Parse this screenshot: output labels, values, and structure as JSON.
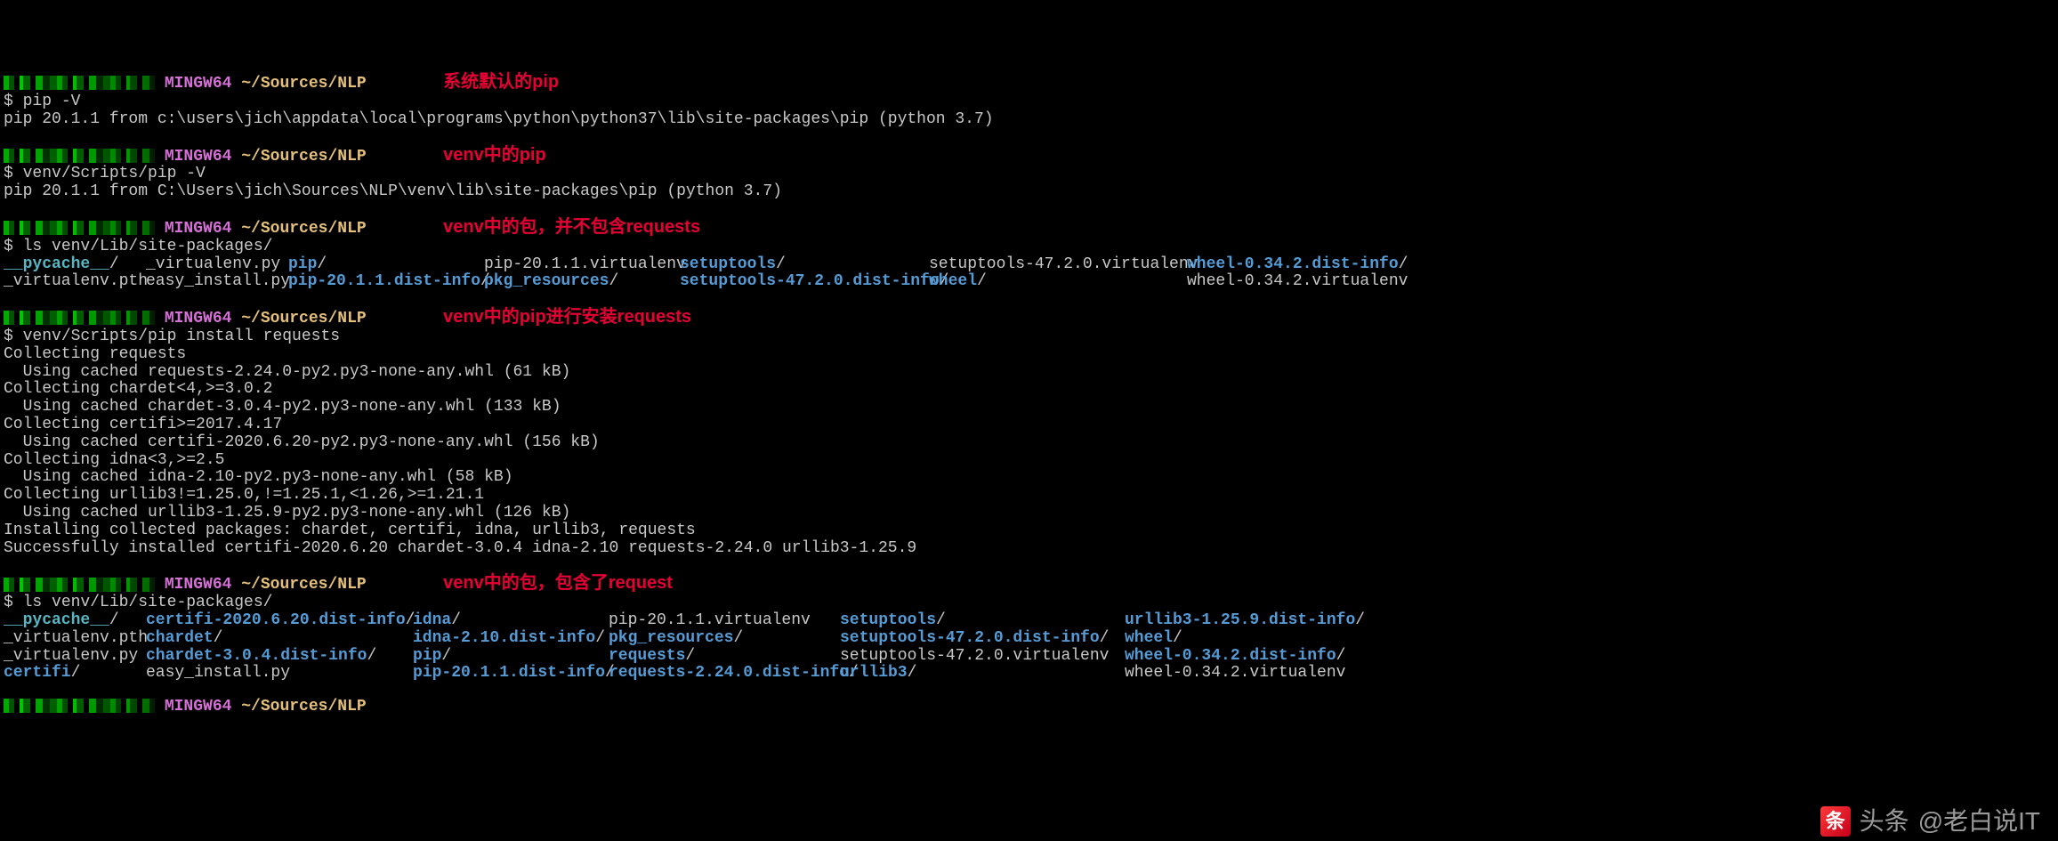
{
  "prompt": {
    "shell": "MINGW64",
    "path": "~/Sources/NLP"
  },
  "blocks": [
    {
      "ann": "系统默认的pip",
      "cmd": "pip -V",
      "out": [
        [
          "pip 20.1.1 from c:\\users\\jich\\appdata\\local\\programs\\python\\python37\\lib\\site-packages\\pip (python 3.7)"
        ]
      ]
    },
    {
      "ann": "venv中的pip",
      "cmd": "venv/Scripts/pip -V",
      "out": [
        [
          "pip 20.1.1 from C:\\Users\\jich\\Sources\\NLP\\venv\\lib\\site-packages\\pip (python 3.7)"
        ]
      ]
    },
    {
      "ann": "venv中的包，并不包含requests",
      "cmd": "ls venv/Lib/site-packages/",
      "ls": [
        [
          {
            "t": "__pycache__",
            "c": "cyan-link",
            "slash": "/"
          },
          {
            "t": "_virtualenv.py",
            "c": "white"
          },
          {
            "t": "pip",
            "c": "blue",
            "slash": "/"
          },
          {
            "t": "pip-20.1.1.virtualenv",
            "c": "white"
          },
          {
            "t": "setuptools",
            "c": "blue",
            "slash": "/"
          },
          {
            "t": "setuptools-47.2.0.virtualenv",
            "c": "white"
          },
          {
            "t": "wheel-0.34.2.dist-info",
            "c": "blue",
            "slash": "/"
          }
        ],
        [
          {
            "t": "_virtualenv.pth",
            "c": "white"
          },
          {
            "t": "easy_install.py",
            "c": "white"
          },
          {
            "t": "pip-20.1.1.dist-info",
            "c": "blue",
            "slash": "/"
          },
          {
            "t": "pkg_resources",
            "c": "blue",
            "slash": "/"
          },
          {
            "t": "setuptools-47.2.0.dist-info",
            "c": "blue",
            "slash": "/"
          },
          {
            "t": "wheel",
            "c": "blue",
            "slash": "/"
          },
          {
            "t": "wheel-0.34.2.virtualenv",
            "c": "white"
          }
        ]
      ],
      "ls_widths": [
        160,
        160,
        220,
        220,
        280,
        290,
        260
      ]
    },
    {
      "ann": "venv中的pip进行安装requests",
      "cmd": "venv/Scripts/pip install requests",
      "out": [
        [
          "Collecting requests"
        ],
        [
          "  Using cached requests-2.24.0-py2.py3-none-any.whl (61 kB)"
        ],
        [
          "Collecting chardet<4,>=3.0.2"
        ],
        [
          "  Using cached chardet-3.0.4-py2.py3-none-any.whl (133 kB)"
        ],
        [
          "Collecting certifi>=2017.4.17"
        ],
        [
          "  Using cached certifi-2020.6.20-py2.py3-none-any.whl (156 kB)"
        ],
        [
          "Collecting idna<3,>=2.5"
        ],
        [
          "  Using cached idna-2.10-py2.py3-none-any.whl (58 kB)"
        ],
        [
          "Collecting urllib3!=1.25.0,!=1.25.1,<1.26,>=1.21.1"
        ],
        [
          "  Using cached urllib3-1.25.9-py2.py3-none-any.whl (126 kB)"
        ],
        [
          "Installing collected packages: chardet, certifi, idna, urllib3, requests"
        ],
        [
          "Successfully installed certifi-2020.6.20 chardet-3.0.4 idna-2.10 requests-2.24.0 urllib3-1.25.9"
        ]
      ]
    },
    {
      "ann": "venv中的包，包含了request",
      "cmd": "ls venv/Lib/site-packages/",
      "ls": [
        [
          {
            "t": "__pycache__",
            "c": "cyan-link",
            "slash": "/"
          },
          {
            "t": "certifi-2020.6.20.dist-info",
            "c": "blue",
            "slash": "/"
          },
          {
            "t": "idna",
            "c": "blue",
            "slash": "/"
          },
          {
            "t": "pip-20.1.1.virtualenv",
            "c": "white"
          },
          {
            "t": "setuptools",
            "c": "blue",
            "slash": "/"
          },
          {
            "t": "urllib3-1.25.9.dist-info",
            "c": "blue",
            "slash": "/"
          }
        ],
        [
          {
            "t": "_virtualenv.pth",
            "c": "white"
          },
          {
            "t": "chardet",
            "c": "blue",
            "slash": "/"
          },
          {
            "t": "idna-2.10.dist-info",
            "c": "blue",
            "slash": "/"
          },
          {
            "t": "pkg_resources",
            "c": "blue",
            "slash": "/"
          },
          {
            "t": "setuptools-47.2.0.dist-info",
            "c": "blue",
            "slash": "/"
          },
          {
            "t": "wheel",
            "c": "blue",
            "slash": "/"
          }
        ],
        [
          {
            "t": "_virtualenv.py",
            "c": "white"
          },
          {
            "t": "chardet-3.0.4.dist-info",
            "c": "blue",
            "slash": "/"
          },
          {
            "t": "pip",
            "c": "blue",
            "slash": "/"
          },
          {
            "t": "requests",
            "c": "blue",
            "slash": "/"
          },
          {
            "t": "setuptools-47.2.0.virtualenv",
            "c": "white"
          },
          {
            "t": "wheel-0.34.2.dist-info",
            "c": "blue",
            "slash": "/"
          }
        ],
        [
          {
            "t": "certifi",
            "c": "blue",
            "slash": "/"
          },
          {
            "t": "easy_install.py",
            "c": "white"
          },
          {
            "t": "pip-20.1.1.dist-info",
            "c": "blue",
            "slash": "/"
          },
          {
            "t": "requests-2.24.0.dist-info",
            "c": "blue",
            "slash": "/"
          },
          {
            "t": "urllib3",
            "c": "blue",
            "slash": "/"
          },
          {
            "t": "wheel-0.34.2.virtualenv",
            "c": "white"
          }
        ]
      ],
      "ls_widths": [
        160,
        300,
        220,
        260,
        320,
        300
      ]
    },
    {
      "ann": "",
      "cmd": null,
      "final_prompt": true
    }
  ],
  "watermark": {
    "prefix": "头条",
    "author": "@老白说IT"
  }
}
